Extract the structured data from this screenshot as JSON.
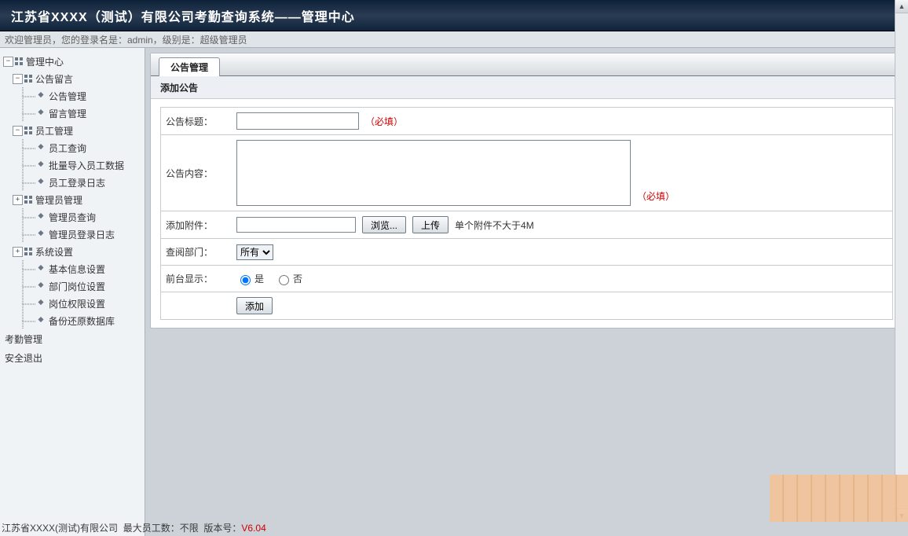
{
  "title": "江苏省XXXX（测试）有限公司考勤查询系统——管理中心",
  "welcome": {
    "text": "欢迎管理员，您的登录名是：admin，级别是：超级管理员"
  },
  "tree": {
    "minus": "−",
    "plus": "+",
    "root": "管理中心",
    "g1": {
      "label": "公告留言",
      "c": [
        "公告管理",
        "留言管理"
      ]
    },
    "g2": {
      "label": "员工管理",
      "c": [
        "员工查询",
        "批量导入员工数据",
        "员工登录日志"
      ]
    },
    "g3": {
      "label": "管理员管理",
      "c": [
        "管理员查询",
        "管理员登录日志"
      ]
    },
    "g4": {
      "label": "系统设置",
      "c": [
        "基本信息设置",
        "部门岗位设置",
        "岗位权限设置",
        "备份还原数据库"
      ]
    }
  },
  "flat": {
    "a": "考勤管理",
    "b": "安全退出"
  },
  "panel": {
    "tab": "公告管理",
    "section": "添加公告",
    "rows": {
      "title": "公告标题：",
      "content": "公告内容：",
      "attach": "添加附件：",
      "dept": "查阅部门：",
      "front": "前台显示："
    },
    "required": "（必填）",
    "browse": "浏览...",
    "upload": "上传",
    "attach_hint": "单个附件不大于4M",
    "dept_sel": "所有",
    "radio_yes": "是",
    "radio_no": "否",
    "submit": "添加"
  },
  "footer": {
    "company": "江苏省XXXX(测试)有限公司",
    "limit": "最大员工数：不限",
    "version_lbl": "版本号：",
    "version": "V6.04"
  }
}
